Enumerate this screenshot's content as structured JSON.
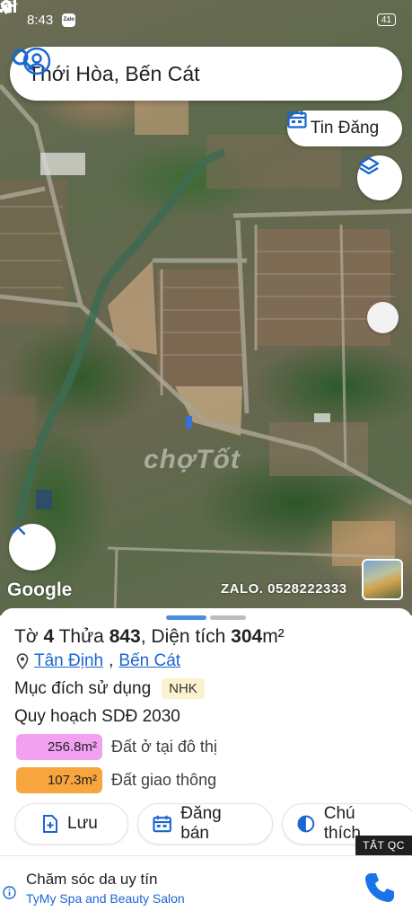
{
  "status": {
    "time": "8:43",
    "app_badge": "Zalo",
    "battery": "41"
  },
  "search": {
    "query": "Thới Hòa, Bến Cát"
  },
  "map": {
    "chip_tin_dang": "Tin Đăng",
    "watermark": "chợTốt",
    "google": "Google",
    "zalo": "ZALO. 0528222333"
  },
  "parcel": {
    "to_label": "Tờ",
    "to_value": "4",
    "thua_label": "Thửa",
    "thua_value": "843",
    "area_label": ", Diện tích",
    "area_value": "304",
    "area_unit": "m²",
    "ward": "Tân Định",
    "separator": ",",
    "district": "Bến Cát",
    "purpose_label": "Mục đích sử dụng",
    "purpose_code": "NHK",
    "plan_label": "Quy hoạch SDĐ 2030",
    "areas": [
      {
        "value": "256.8m²",
        "desc": "Đất ở tại đô thị",
        "color": "#f2a1f1"
      },
      {
        "value": "107.3m²",
        "desc": "Đất giao thông",
        "color": "#f7a53c"
      }
    ]
  },
  "actions": {
    "save": "Lưu",
    "post": "Đăng bán",
    "share": "Chú thích"
  },
  "ad": {
    "close_label": "TẮT QC",
    "title": "Chăm sóc da uy tín",
    "subtitle": "TyMy Spa and Beauty Salon"
  },
  "colors": {
    "accent": "#1a73e8",
    "link": "#1a66d2"
  }
}
